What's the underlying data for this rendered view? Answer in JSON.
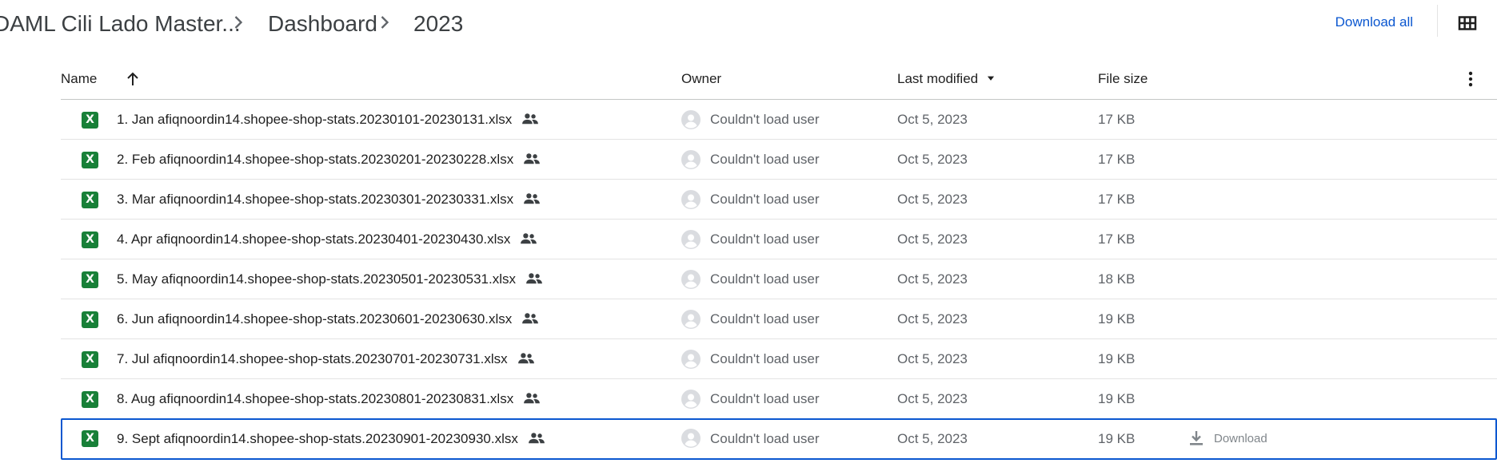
{
  "header": {
    "breadcrumbs": [
      "DAML Cili Lado Master...",
      "Dashboard",
      "2023"
    ],
    "download_all_label": "Download all"
  },
  "table": {
    "columns": {
      "name": "Name",
      "owner": "Owner",
      "last_modified": "Last modified",
      "file_size": "File size"
    },
    "rows": [
      {
        "name": "1. Jan afiqnoordin14.shopee-shop-stats.20230101-20230131.xlsx",
        "owner": "Couldn't load user",
        "modified": "Oct 5, 2023",
        "size": "17 KB"
      },
      {
        "name": "2. Feb afiqnoordin14.shopee-shop-stats.20230201-20230228.xlsx",
        "owner": "Couldn't load user",
        "modified": "Oct 5, 2023",
        "size": "17 KB"
      },
      {
        "name": "3. Mar afiqnoordin14.shopee-shop-stats.20230301-20230331.xlsx",
        "owner": "Couldn't load user",
        "modified": "Oct 5, 2023",
        "size": "17 KB"
      },
      {
        "name": "4. Apr afiqnoordin14.shopee-shop-stats.20230401-20230430.xlsx",
        "owner": "Couldn't load user",
        "modified": "Oct 5, 2023",
        "size": "17 KB"
      },
      {
        "name": "5. May afiqnoordin14.shopee-shop-stats.20230501-20230531.xlsx",
        "owner": "Couldn't load user",
        "modified": "Oct 5, 2023",
        "size": "18 KB"
      },
      {
        "name": "6. Jun afiqnoordin14.shopee-shop-stats.20230601-20230630.xlsx",
        "owner": "Couldn't load user",
        "modified": "Oct 5, 2023",
        "size": "19 KB"
      },
      {
        "name": "7. Jul afiqnoordin14.shopee-shop-stats.20230701-20230731.xlsx",
        "owner": "Couldn't load user",
        "modified": "Oct 5, 2023",
        "size": "19 KB"
      },
      {
        "name": "8. Aug afiqnoordin14.shopee-shop-stats.20230801-20230831.xlsx",
        "owner": "Couldn't load user",
        "modified": "Oct 5, 2023",
        "size": "19 KB"
      },
      {
        "name": "9. Sept afiqnoordin14.shopee-shop-stats.20230901-20230930.xlsx",
        "owner": "Couldn't load user",
        "modified": "Oct 5, 2023",
        "size": "19 KB",
        "download_label": "Download"
      }
    ]
  },
  "icons": {
    "file_type": "excel-icon",
    "file_type_glyph": "X",
    "shared": "shared-people-icon",
    "owner": "user-avatar-icon",
    "sort": "arrow-up-icon",
    "sort_dropdown": "caret-down-icon",
    "more": "more-vert-icon",
    "view_toggle": "grid-view-icon",
    "download": "download-icon"
  },
  "colors": {
    "accent": "#0b57d0",
    "excel_green": "#188038",
    "border": "#e3e3e3",
    "muted_text": "#5f6368"
  }
}
